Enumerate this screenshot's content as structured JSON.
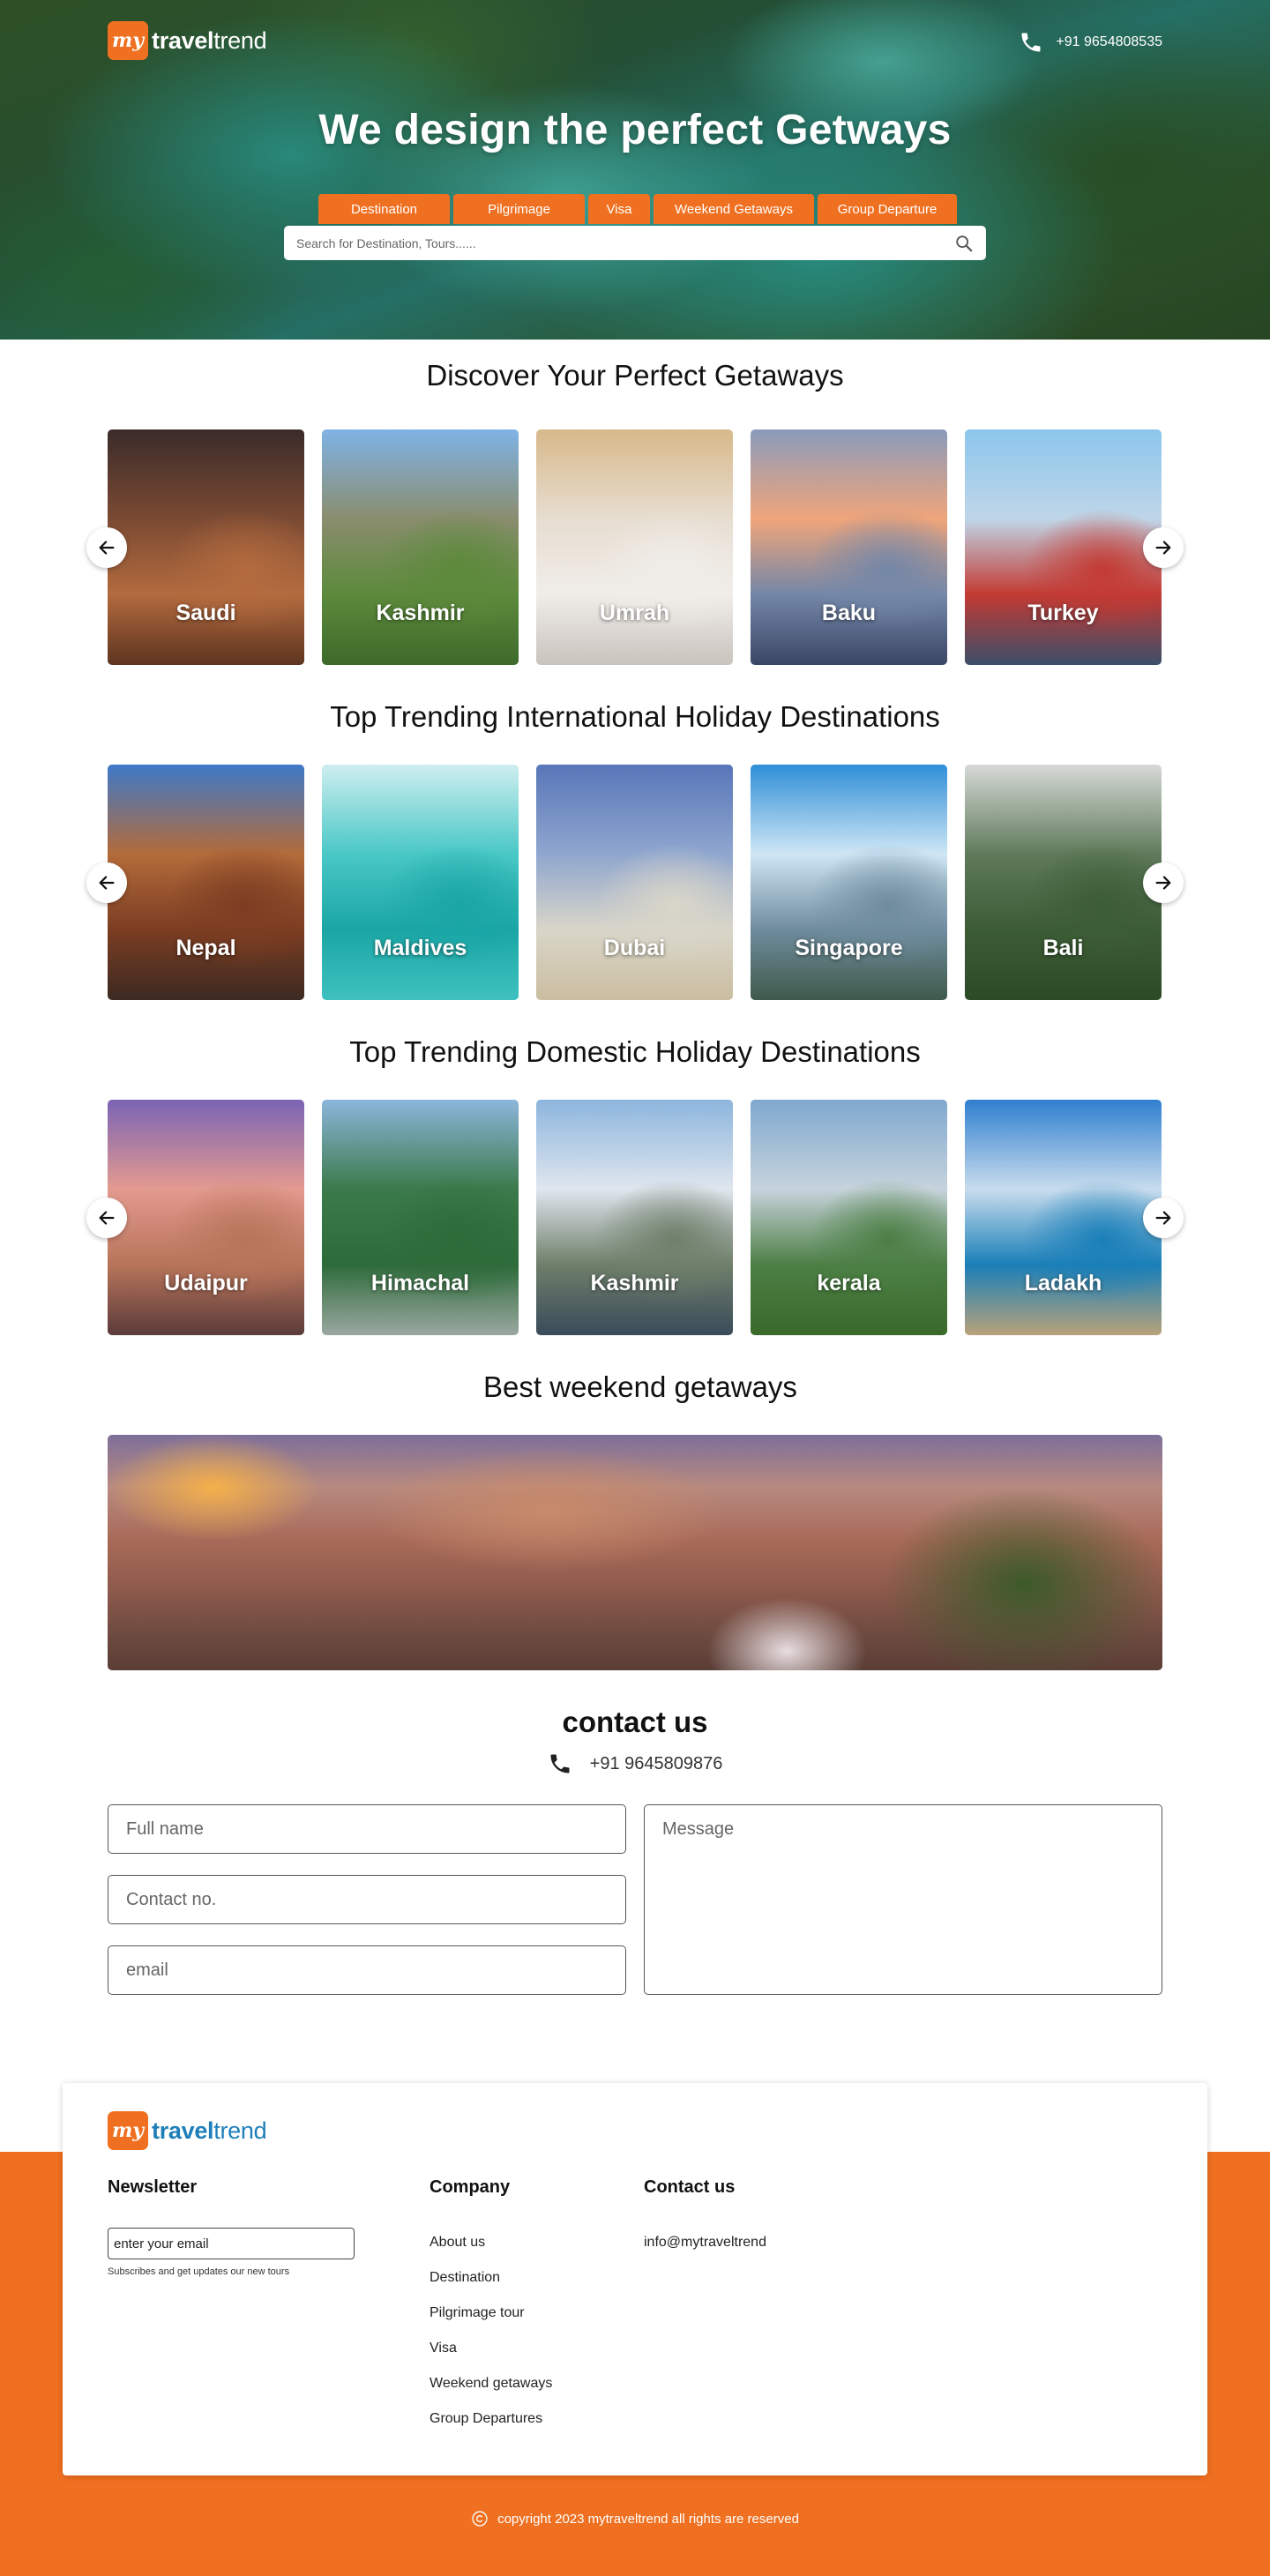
{
  "header": {
    "brand_mark": "my",
    "brand_bold": "travel",
    "brand_rest": "trend",
    "phone": "+91 9654808535",
    "title": "We  design the perfect Getways",
    "tabs": [
      "Destination",
      "Pilgrimage",
      "Visa",
      "Weekend Getaways",
      "Group Departure"
    ],
    "search_placeholder": "Search for Destination, Tours......"
  },
  "sections": [
    {
      "title": "Discover Your  Perfect Getaways",
      "cards": [
        {
          "label": "Saudi",
          "colors": [
            "#3b2b2a",
            "#7a4a33",
            "#b36a3e",
            "#5e3520"
          ]
        },
        {
          "label": "Kashmir",
          "colors": [
            "#7fb3e6",
            "#8a8d6e",
            "#5c8a3b",
            "#3d6a2a"
          ]
        },
        {
          "label": "Umrah",
          "colors": [
            "#d7b98a",
            "#e7ddd0",
            "#f0ede9",
            "#c9c3bd"
          ]
        },
        {
          "label": "Baku",
          "colors": [
            "#8a9bbc",
            "#f0a57a",
            "#7487a8",
            "#3b4666"
          ]
        },
        {
          "label": "Turkey",
          "colors": [
            "#8cc6ec",
            "#bfd6e8",
            "#c33a33",
            "#3b4f6a"
          ]
        }
      ]
    },
    {
      "title": "Top Trending International Holiday Destinations",
      "cards": [
        {
          "label": "Nepal",
          "colors": [
            "#3e79c9",
            "#b36b3a",
            "#7c3d22",
            "#3b2a22"
          ]
        },
        {
          "label": "Maldives",
          "colors": [
            "#cfeef0",
            "#49c8c6",
            "#1aa6a5",
            "#3fc1bf"
          ]
        },
        {
          "label": "Dubai",
          "colors": [
            "#5876b8",
            "#8fa6cf",
            "#d9d6c9",
            "#cbbda0"
          ]
        },
        {
          "label": "Singapore",
          "colors": [
            "#2f8fd8",
            "#cfe6f5",
            "#6f8c9e",
            "#3f5a4a"
          ]
        },
        {
          "label": "Bali",
          "colors": [
            "#d7dad8",
            "#5f7a5a",
            "#3c5c36",
            "#2d4a26"
          ]
        }
      ]
    },
    {
      "title": "Top Trending Domestic  Holiday Destinations",
      "cards": [
        {
          "label": "Udaipur",
          "colors": [
            "#7b64b5",
            "#e39a8f",
            "#b8745a",
            "#5b3b3b"
          ]
        },
        {
          "label": "Himachal",
          "colors": [
            "#8db6dd",
            "#3b7a4a",
            "#2e6b3a",
            "#9aa8a0"
          ]
        },
        {
          "label": "Kashmir",
          "colors": [
            "#8cb5dd",
            "#dfe6ee",
            "#6f7f6a",
            "#3a4b5a"
          ]
        },
        {
          "label": "kerala",
          "colors": [
            "#7fa8cf",
            "#c7d3dc",
            "#4c7f45",
            "#3a6a2a"
          ]
        },
        {
          "label": "Ladakh",
          "colors": [
            "#2f7fcf",
            "#c8dced",
            "#1a7fb8",
            "#b9a27a"
          ]
        }
      ]
    }
  ],
  "weekend": {
    "title": "Best weekend getaways"
  },
  "contact": {
    "title": "contact us",
    "phone": "+91 9645809876",
    "full_name_placeholder": "Full name",
    "contact_placeholder": "Contact no.",
    "email_placeholder": "email",
    "message_placeholder": "Message"
  },
  "footer": {
    "newsletter_title": "Newsletter",
    "newsletter_placeholder": "enter your email",
    "newsletter_note": "Subscribes and get updates our new tours",
    "company_title": "Company",
    "company_links": [
      "About us",
      "Destination",
      "Pilgrimage tour",
      "Visa",
      "Weekend getaways",
      "Group Departures"
    ],
    "contact_title": "Contact us",
    "contact_email": "info@mytraveltrend",
    "copyright": "copyright 2023 mytraveltrend all rights are reserved"
  },
  "colors": {
    "accent": "#f07021",
    "footer_brand": "#1e7fb8"
  },
  "icons": {
    "phone": "phone-icon",
    "search": "search-icon",
    "arrow_left": "arrow-left-icon",
    "arrow_right": "arrow-right-icon",
    "copyright": "copyright-icon"
  }
}
